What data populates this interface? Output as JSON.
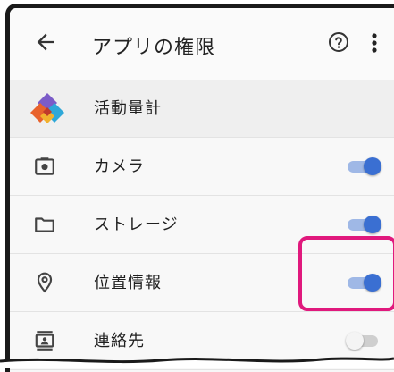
{
  "header": {
    "back_icon": "arrow-left-icon",
    "title": "アプリの権限",
    "help_icon": "help-circle-icon",
    "more_icon": "more-vertical-icon"
  },
  "app": {
    "name": "活動量計",
    "logo_icon": "app-logo-icon"
  },
  "permissions": [
    {
      "label": "カメラ",
      "icon": "camera-icon",
      "enabled": true
    },
    {
      "label": "ストレージ",
      "icon": "folder-icon",
      "enabled": true
    },
    {
      "label": "位置情報",
      "icon": "location-pin-icon",
      "enabled": true
    },
    {
      "label": "連絡先",
      "icon": "contacts-icon",
      "enabled": false
    }
  ],
  "colors": {
    "accent": "#3a6fd2",
    "highlight": "#e0197d"
  }
}
